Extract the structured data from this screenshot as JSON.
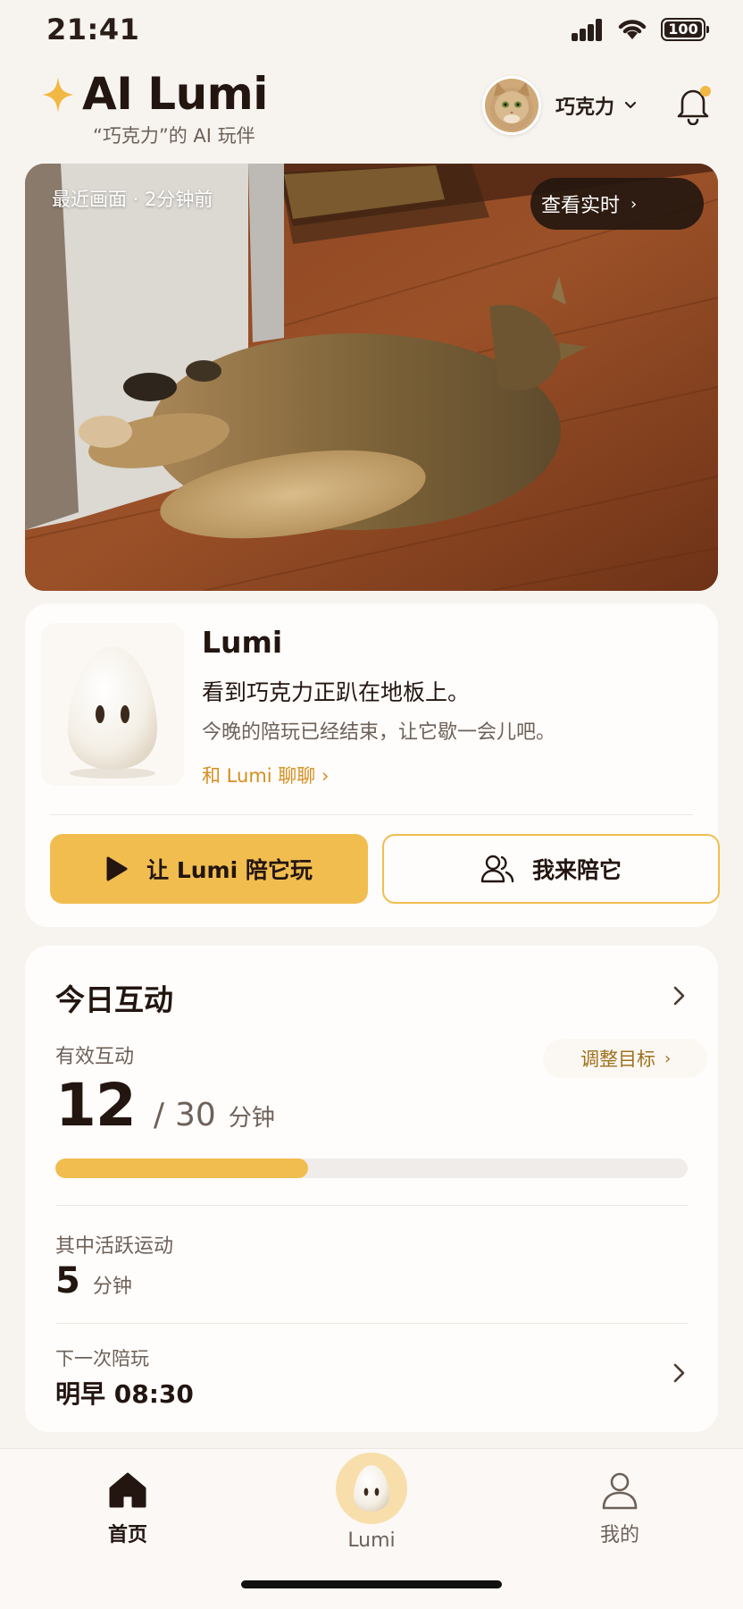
{
  "status_bar": {
    "time": "21:41",
    "battery": "100"
  },
  "header": {
    "title": "AI Lumi",
    "subtitle": "“巧克力”的 AI 玩伴",
    "pet_name": "巧克力"
  },
  "camera": {
    "label": "最近画面 · 2分钟前",
    "live_button": "查看实时",
    "live_arrow": "›"
  },
  "lumi_card": {
    "name": "Lumi",
    "message": "看到巧克力正趴在地板上。",
    "sub_message": "今晚的陪玩已经结束，让它歇一会儿吧。",
    "chat_link": "和 Lumi 聊聊 ›",
    "play_button": "让 Lumi 陪它玩",
    "me_button": "我来陪它"
  },
  "today": {
    "title": "今日互动",
    "effective_label": "有效互动",
    "adjust_goal": "调整目标",
    "adjust_arrow": "›",
    "effective_value": "12",
    "separator": "/",
    "goal_value": "30",
    "unit": "分钟",
    "progress_fraction": 0.4,
    "active_label": "其中活跃运动",
    "active_value": "5",
    "active_unit": "分钟",
    "next_label": "下一次陪玩",
    "next_value": "明早 08:30"
  },
  "tab_bar": {
    "tabs": [
      {
        "label": "首页",
        "icon": "home-icon",
        "active": true
      },
      {
        "label": "Lumi",
        "icon": "lumi-icon",
        "active": false
      },
      {
        "label": "我的",
        "icon": "user-icon",
        "active": false
      }
    ]
  },
  "colors": {
    "accent": "#f1bd4f",
    "link": "#d58e1e",
    "text": "#231510",
    "muted": "#6d6159",
    "background": "#f7f4f0"
  }
}
